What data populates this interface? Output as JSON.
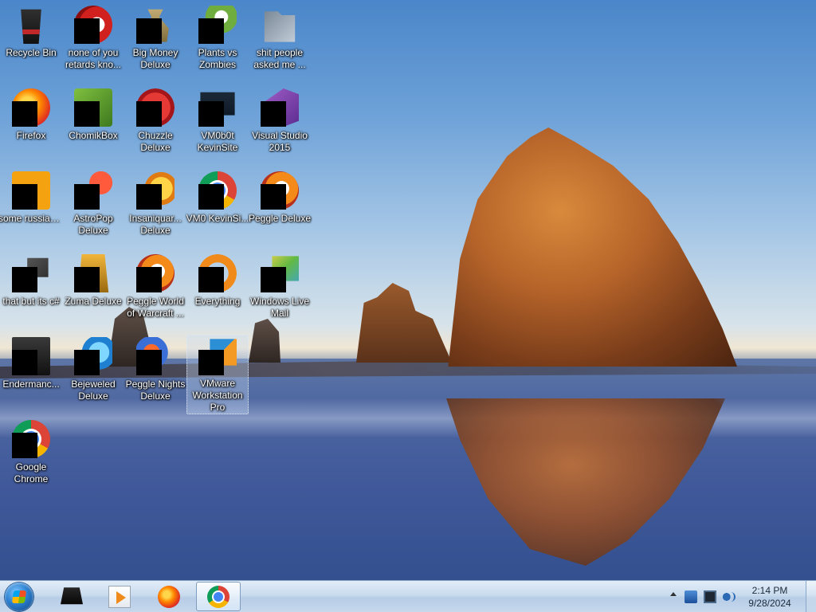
{
  "desktop": {
    "icons": [
      {
        "label": "Recycle Bin"
      },
      {
        "label": "none of you retards kno..."
      },
      {
        "label": "Big Money Deluxe"
      },
      {
        "label": "Plants vs Zombies"
      },
      {
        "label": "shit people asked me ..."
      },
      {
        "label": "Firefox"
      },
      {
        "label": "ChomikBox"
      },
      {
        "label": "Chuzzle Deluxe"
      },
      {
        "label": "VM0b0t KevinSite"
      },
      {
        "label": "Visual Studio 2015"
      },
      {
        "label": "some russian ran a rat"
      },
      {
        "label": "AstroPop Deluxe"
      },
      {
        "label": "Insaniquar... Deluxe"
      },
      {
        "label": "VM0 KevinSi..."
      },
      {
        "label": "Peggle Deluxe"
      },
      {
        "label": "that but its c#"
      },
      {
        "label": "Zuma Deluxe"
      },
      {
        "label": "Peggle World of Warcraft ..."
      },
      {
        "label": "Everything"
      },
      {
        "label": "Windows Live Mail"
      },
      {
        "label": "Endermanc..."
      },
      {
        "label": "Bejeweled Deluxe"
      },
      {
        "label": "Peggle Nights Deluxe"
      },
      {
        "label": "VMware Workstation Pro"
      },
      {
        "label": "Google Chrome"
      }
    ]
  },
  "taskbar": {
    "pinned": [
      {
        "name": "terminal-icon"
      },
      {
        "name": "media-player-icon"
      },
      {
        "name": "firefox-icon"
      },
      {
        "name": "chrome-icon"
      }
    ],
    "clock": {
      "time": "2:14 PM",
      "date": "9/28/2024"
    }
  }
}
